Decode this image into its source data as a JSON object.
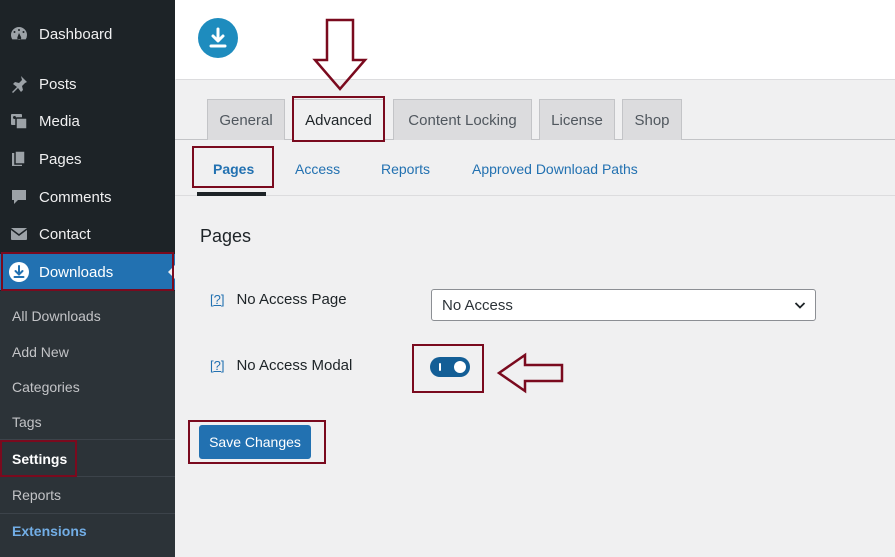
{
  "sidebar": {
    "items": [
      {
        "label": "Dashboard",
        "icon": "dashboard-icon"
      },
      {
        "label": "Posts",
        "icon": "pin-icon"
      },
      {
        "label": "Media",
        "icon": "media-icon"
      },
      {
        "label": "Pages",
        "icon": "pages-icon"
      },
      {
        "label": "Comments",
        "icon": "comment-icon"
      },
      {
        "label": "Contact",
        "icon": "mail-icon"
      },
      {
        "label": "Downloads",
        "icon": "download-icon"
      }
    ],
    "submenu": [
      {
        "label": "All Downloads"
      },
      {
        "label": "Add New"
      },
      {
        "label": "Categories"
      },
      {
        "label": "Tags"
      },
      {
        "label": "Settings"
      },
      {
        "label": "Reports"
      },
      {
        "label": "Extensions"
      }
    ]
  },
  "tabs": [
    {
      "label": "General"
    },
    {
      "label": "Advanced"
    },
    {
      "label": "Content Locking"
    },
    {
      "label": "License"
    },
    {
      "label": "Shop"
    }
  ],
  "subtabs": [
    {
      "label": "Pages"
    },
    {
      "label": "Access"
    },
    {
      "label": "Reports"
    },
    {
      "label": "Approved Download Paths"
    }
  ],
  "section": {
    "title": "Pages"
  },
  "fields": {
    "no_access_page": {
      "help": "[?]",
      "label": "No Access Page",
      "value": "No Access"
    },
    "no_access_modal": {
      "help": "[?]",
      "label": "No Access Modal",
      "enabled": true
    }
  },
  "save_label": "Save Changes",
  "colors": {
    "accent": "#2271b1",
    "sidebar_bg": "#1d2327",
    "highlight": "#7a0a1e"
  }
}
